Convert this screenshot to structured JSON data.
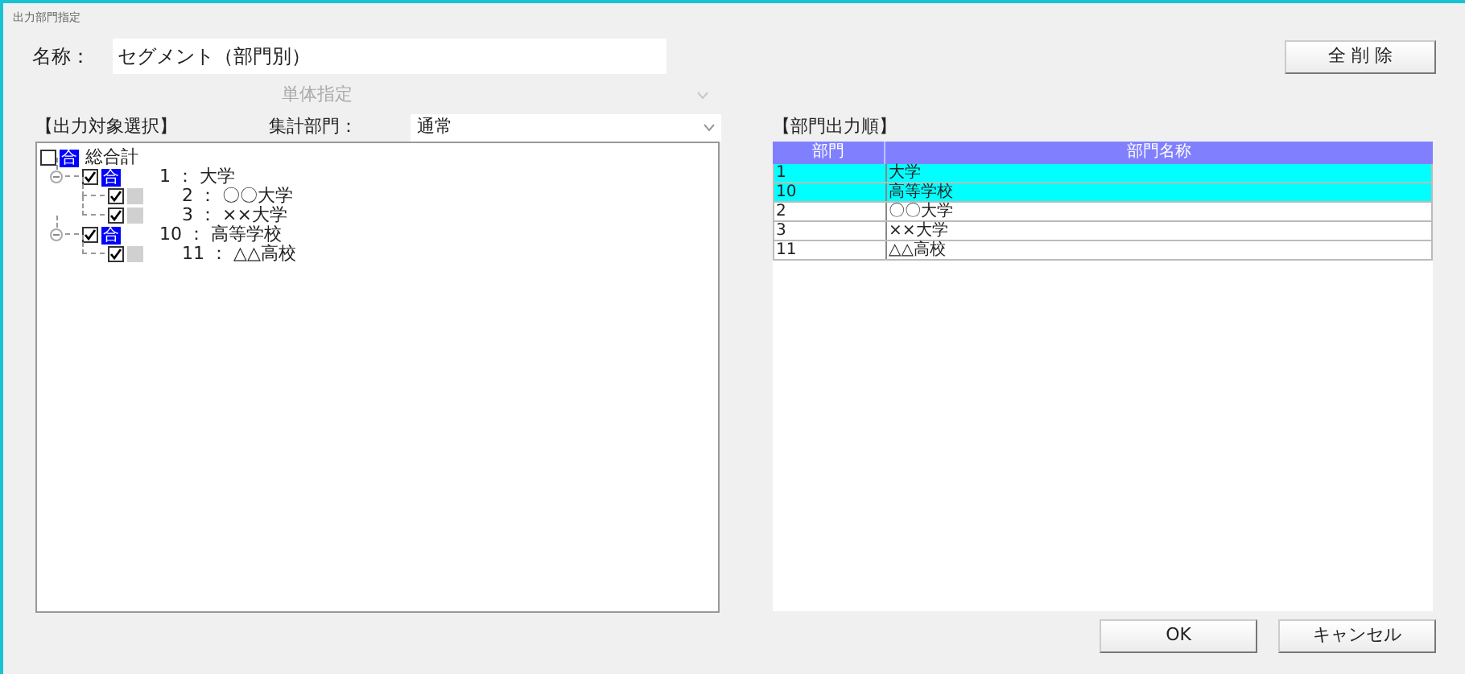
{
  "window": {
    "title": "出力部門指定"
  },
  "name_field": {
    "label": "名称：",
    "value": "セグメント（部門別）"
  },
  "delete_all_button": "全 削 除",
  "mode_select": {
    "value": "単体指定",
    "disabled": true
  },
  "output_selection": {
    "label": "【出力対象選択】"
  },
  "aggregate_select": {
    "label": "集計部門：",
    "value": "通常",
    "disabled": false
  },
  "tree": [
    {
      "label": "総合計",
      "checked": false,
      "badge": "合",
      "kind": "group",
      "children": [
        {
          "label": "1 ： 大学",
          "checked": true,
          "badge": "合",
          "kind": "group",
          "expanded": true,
          "children": [
            {
              "label": "2 ： 〇〇大学",
              "checked": true,
              "kind": "dept"
            },
            {
              "label": "3 ： ××大学",
              "checked": true,
              "kind": "dept"
            }
          ]
        },
        {
          "label": "10 ： 高等学校",
          "checked": true,
          "badge": "合",
          "kind": "group",
          "expanded": true,
          "children": [
            {
              "label": "11 ： △△高校",
              "checked": true,
              "kind": "dept"
            }
          ]
        }
      ]
    }
  ],
  "order": {
    "label": "【部門出力順】",
    "columns": [
      "部門",
      "部門名称"
    ],
    "rows": [
      {
        "cells": [
          "1",
          "大学"
        ],
        "selected": true
      },
      {
        "cells": [
          "10",
          "高等学校"
        ],
        "selected": true
      },
      {
        "cells": [
          "2",
          "〇〇大学"
        ],
        "selected": false
      },
      {
        "cells": [
          "3",
          "××大学"
        ],
        "selected": false
      },
      {
        "cells": [
          "11",
          "△△高校"
        ],
        "selected": false
      }
    ]
  },
  "buttons": [
    "OK",
    "キャンセル"
  ]
}
